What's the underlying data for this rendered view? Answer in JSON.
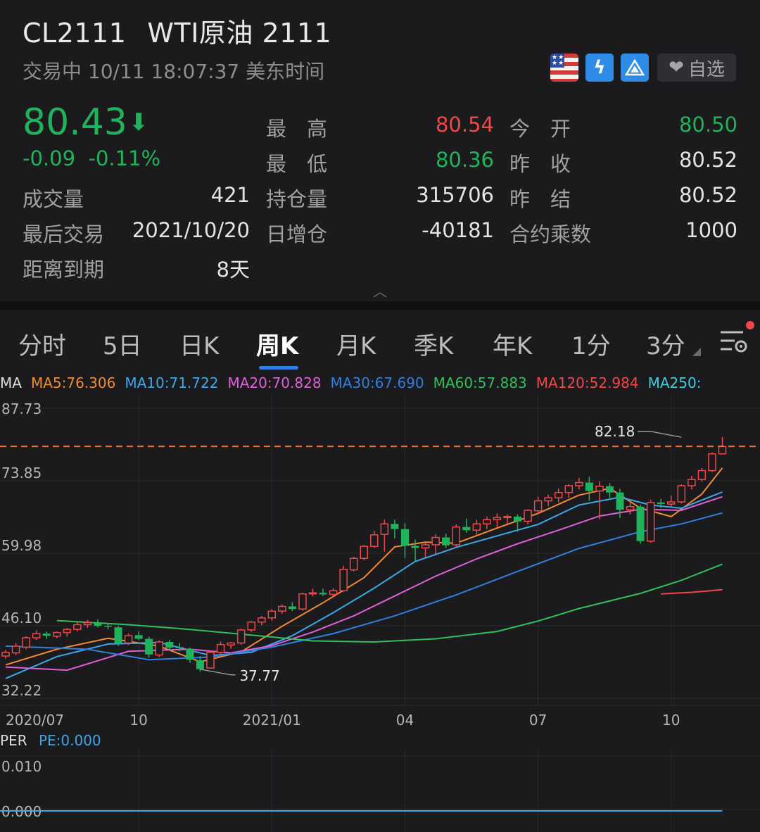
{
  "header": {
    "symbol": "CL2111",
    "name": "WTI原油 2111",
    "status": "交易中 10/11 18:07:37 美东时间",
    "watch_label": "自选",
    "price": "80.43",
    "change": "-0.09",
    "change_pct": "-0.11%",
    "stats": {
      "high_label": "最　高",
      "high": "80.54",
      "open_label": "今　开",
      "open": "80.50",
      "low_label": "最　低",
      "low": "80.36",
      "prev_close_label": "昨　收",
      "prev_close": "80.52",
      "volume_label": "成交量",
      "volume": "421",
      "oi_label": "持仓量",
      "oi": "315706",
      "settle_label": "昨　结",
      "settle": "80.52",
      "last_trade_label": "最后交易",
      "last_trade": "2021/10/20",
      "oi_change_label": "日增仓",
      "oi_change": "-40181",
      "multiplier_label": "合约乘数",
      "multiplier": "1000",
      "expiry_label": "距离到期",
      "expiry": "8天"
    },
    "colors": {
      "up": "#f0474a",
      "down": "#1fb35b"
    }
  },
  "tabs": {
    "items": [
      "分时",
      "5日",
      "日K",
      "周K",
      "月K",
      "季K",
      "年K",
      "1分",
      "3分"
    ],
    "active": "周K"
  },
  "ma_legend": [
    {
      "label": "MA",
      "color": "#dcdcdc"
    },
    {
      "label": "MA5:76.306",
      "color": "#f28a2e"
    },
    {
      "label": "MA10:71.722",
      "color": "#3aa8e8"
    },
    {
      "label": "MA20:70.828",
      "color": "#e05fd6"
    },
    {
      "label": "MA30:67.690",
      "color": "#2f7fe0"
    },
    {
      "label": "MA60:57.883",
      "color": "#2fbf5c"
    },
    {
      "label": "MA120:52.984",
      "color": "#f0474a"
    },
    {
      "label": "MA250:",
      "color": "#33d0e0"
    }
  ],
  "per": {
    "label": "PER",
    "value_label": "PE:0.000",
    "y_ticks": [
      "0.010",
      "0.000"
    ]
  },
  "chart_data": {
    "type": "candlestick",
    "period": "weekly",
    "y_ticks": [
      87.73,
      73.85,
      59.98,
      46.1,
      32.22
    ],
    "ylim": [
      32.22,
      87.73
    ],
    "x_labels": [
      {
        "label": "2020/07",
        "index": 0
      },
      {
        "label": "10",
        "index": 13
      },
      {
        "label": "2021/01",
        "index": 26
      },
      {
        "label": "04",
        "index": 39
      },
      {
        "label": "07",
        "index": 52
      },
      {
        "label": "10",
        "index": 65
      }
    ],
    "last_price_line": 80.43,
    "annotations": [
      {
        "label": "82.18",
        "index": 66,
        "value": 82.18,
        "side": "left"
      },
      {
        "label": "37.77",
        "index": 19,
        "value": 37.77,
        "side": "right"
      }
    ],
    "candles": [
      [
        40.3,
        41.5,
        39.8,
        41.0
      ],
      [
        40.9,
        42.8,
        40.5,
        42.2
      ],
      [
        42.0,
        44.1,
        41.6,
        43.8
      ],
      [
        43.8,
        45.2,
        43.4,
        44.6
      ],
      [
        44.6,
        45.0,
        43.6,
        44.2
      ],
      [
        44.1,
        45.0,
        43.7,
        44.8
      ],
      [
        44.8,
        45.7,
        44.0,
        45.4
      ],
      [
        45.4,
        46.8,
        45.0,
        46.3
      ],
      [
        46.3,
        47.2,
        45.7,
        46.7
      ],
      [
        46.7,
        47.3,
        45.8,
        46.1
      ],
      [
        46.1,
        46.6,
        45.4,
        45.9
      ],
      [
        45.8,
        46.1,
        42.2,
        42.7
      ],
      [
        42.8,
        44.6,
        42.4,
        44.2
      ],
      [
        44.3,
        45.0,
        43.3,
        43.6
      ],
      [
        43.6,
        44.0,
        40.0,
        40.6
      ],
      [
        40.5,
        43.3,
        40.1,
        43.0
      ],
      [
        43.0,
        43.4,
        41.5,
        41.9
      ],
      [
        42.0,
        42.8,
        41.2,
        41.8
      ],
      [
        41.7,
        41.9,
        39.0,
        39.6
      ],
      [
        39.5,
        40.3,
        37.3,
        37.8
      ],
      [
        38.0,
        41.3,
        37.9,
        41.0
      ],
      [
        41.0,
        43.1,
        40.7,
        42.5
      ],
      [
        42.4,
        43.0,
        41.7,
        42.8
      ],
      [
        42.8,
        45.5,
        42.5,
        45.3
      ],
      [
        45.3,
        47.0,
        44.9,
        46.8
      ],
      [
        46.8,
        48.0,
        46.2,
        47.6
      ],
      [
        47.6,
        49.3,
        47.1,
        48.9
      ],
      [
        48.9,
        50.2,
        48.4,
        49.8
      ],
      [
        49.8,
        50.6,
        48.9,
        49.3
      ],
      [
        49.3,
        52.4,
        49.0,
        52.2
      ],
      [
        52.2,
        53.2,
        51.7,
        52.4
      ],
      [
        52.4,
        53.2,
        51.8,
        52.1
      ],
      [
        52.1,
        53.3,
        51.6,
        52.8
      ],
      [
        52.8,
        57.6,
        52.6,
        56.9
      ],
      [
        56.8,
        59.3,
        56.5,
        59.0
      ],
      [
        59.0,
        61.5,
        58.6,
        61.3
      ],
      [
        61.3,
        64.3,
        61.0,
        63.5
      ],
      [
        63.6,
        66.4,
        60.3,
        65.6
      ],
      [
        65.6,
        66.4,
        62.8,
        64.6
      ],
      [
        64.6,
        65.7,
        59.1,
        61.4
      ],
      [
        61.4,
        62.6,
        58.4,
        61.0
      ],
      [
        61.0,
        61.9,
        59.2,
        61.6
      ],
      [
        61.6,
        63.6,
        59.8,
        63.0
      ],
      [
        63.0,
        63.7,
        61.0,
        61.5
      ],
      [
        61.6,
        65.5,
        61.2,
        65.0
      ],
      [
        65.0,
        66.6,
        63.9,
        64.4
      ],
      [
        64.4,
        66.4,
        63.6,
        65.6
      ],
      [
        65.6,
        67.0,
        64.6,
        66.4
      ],
      [
        66.4,
        67.6,
        65.0,
        66.8
      ],
      [
        66.8,
        67.4,
        65.6,
        67.0
      ],
      [
        67.0,
        67.4,
        64.1,
        66.1
      ],
      [
        66.1,
        68.4,
        65.5,
        68.2
      ],
      [
        68.1,
        70.8,
        67.5,
        70.0
      ],
      [
        70.0,
        71.2,
        69.0,
        70.6
      ],
      [
        70.6,
        72.4,
        69.7,
        71.6
      ],
      [
        71.6,
        73.2,
        70.6,
        72.9
      ],
      [
        72.9,
        74.4,
        72.2,
        73.5
      ],
      [
        73.5,
        74.6,
        70.0,
        71.9
      ],
      [
        71.9,
        73.7,
        66.5,
        72.8
      ],
      [
        72.8,
        73.4,
        70.6,
        71.6
      ],
      [
        71.6,
        72.3,
        66.7,
        68.3
      ],
      [
        68.3,
        70.1,
        67.4,
        68.9
      ],
      [
        68.9,
        69.3,
        61.8,
        62.3
      ],
      [
        62.3,
        70.2,
        62.0,
        69.7
      ],
      [
        69.7,
        70.4,
        68.6,
        69.4
      ],
      [
        69.4,
        71.0,
        68.9,
        69.8
      ],
      [
        69.8,
        73.2,
        69.5,
        72.9
      ],
      [
        72.9,
        74.8,
        72.2,
        74.1
      ],
      [
        74.1,
        76.3,
        73.7,
        75.8
      ],
      [
        75.8,
        79.3,
        75.5,
        79.0
      ],
      [
        79.0,
        82.2,
        78.9,
        80.4
      ]
    ],
    "series": [
      {
        "name": "MA5",
        "color": "#f28a2e",
        "values": [
          [
            0,
            38.6
          ],
          [
            5,
            41.6
          ],
          [
            10,
            43.7
          ],
          [
            15,
            42.2
          ],
          [
            19,
            39.2
          ],
          [
            23,
            41.1
          ],
          [
            27,
            46.0
          ],
          [
            31,
            50.5
          ],
          [
            35,
            55.3
          ],
          [
            38,
            61.2
          ],
          [
            41,
            62.1
          ],
          [
            44,
            61.9
          ],
          [
            48,
            64.8
          ],
          [
            52,
            67.6
          ],
          [
            56,
            71.1
          ],
          [
            59,
            72.4
          ],
          [
            62,
            68.6
          ],
          [
            65,
            67.0
          ],
          [
            68,
            71.3
          ],
          [
            70,
            76.3
          ]
        ]
      },
      {
        "name": "MA10",
        "color": "#3aa8e8",
        "values": [
          [
            0,
            36.0
          ],
          [
            5,
            40.2
          ],
          [
            10,
            42.6
          ],
          [
            15,
            42.9
          ],
          [
            20,
            40.4
          ],
          [
            24,
            41.0
          ],
          [
            28,
            44.2
          ],
          [
            32,
            48.6
          ],
          [
            36,
            53.3
          ],
          [
            40,
            58.4
          ],
          [
            44,
            61.1
          ],
          [
            48,
            63.3
          ],
          [
            52,
            65.5
          ],
          [
            56,
            69.2
          ],
          [
            60,
            70.7
          ],
          [
            63,
            69.2
          ],
          [
            66,
            68.6
          ],
          [
            70,
            71.7
          ]
        ]
      },
      {
        "name": "MA20",
        "color": "#e05fd6",
        "values": [
          [
            0,
            38.2
          ],
          [
            6,
            37.6
          ],
          [
            12,
            41.2
          ],
          [
            18,
            41.6
          ],
          [
            22,
            40.9
          ],
          [
            26,
            42.3
          ],
          [
            30,
            44.9
          ],
          [
            34,
            48.0
          ],
          [
            38,
            51.8
          ],
          [
            42,
            55.6
          ],
          [
            46,
            58.9
          ],
          [
            50,
            61.8
          ],
          [
            54,
            64.4
          ],
          [
            58,
            67.1
          ],
          [
            62,
            68.4
          ],
          [
            66,
            68.2
          ],
          [
            70,
            70.8
          ]
        ]
      },
      {
        "name": "MA30",
        "color": "#2f7fe0",
        "values": [
          [
            0,
            42.2
          ],
          [
            8,
            41.6
          ],
          [
            14,
            39.6
          ],
          [
            20,
            40.1
          ],
          [
            26,
            42.0
          ],
          [
            32,
            44.6
          ],
          [
            38,
            48.0
          ],
          [
            44,
            52.0
          ],
          [
            50,
            56.5
          ],
          [
            56,
            60.9
          ],
          [
            62,
            64.1
          ],
          [
            66,
            65.6
          ],
          [
            70,
            67.7
          ]
        ]
      },
      {
        "name": "MA60",
        "color": "#2fbf5c",
        "values": [
          [
            5,
            47.1
          ],
          [
            12,
            46.3
          ],
          [
            18,
            45.4
          ],
          [
            24,
            44.3
          ],
          [
            30,
            43.2
          ],
          [
            36,
            43.0
          ],
          [
            42,
            43.6
          ],
          [
            48,
            45.0
          ],
          [
            52,
            47.0
          ],
          [
            56,
            49.4
          ],
          [
            62,
            52.3
          ],
          [
            66,
            54.8
          ],
          [
            70,
            57.9
          ]
        ]
      },
      {
        "name": "MA120",
        "color": "#f0474a",
        "values": [
          [
            64,
            52.2
          ],
          [
            67,
            52.5
          ],
          [
            70,
            53.0
          ]
        ]
      }
    ]
  }
}
